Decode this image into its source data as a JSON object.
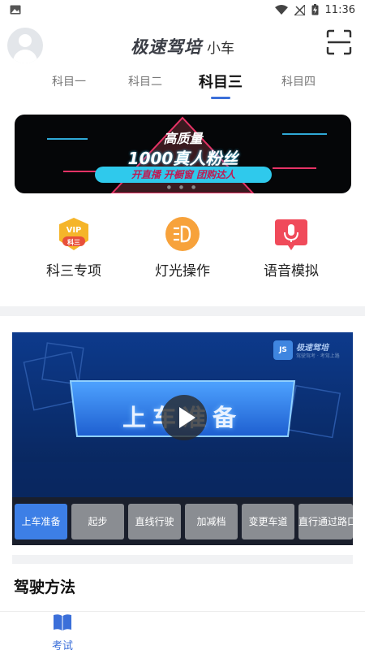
{
  "status_bar": {
    "time": "11:36"
  },
  "header": {
    "brand": "极速驾培",
    "vehicle": "小车"
  },
  "tabs": [
    "科目一",
    "科目二",
    "科目三",
    "科目四"
  ],
  "active_tab": "科目三",
  "banner": {
    "line1": "高质量",
    "line2": "1000真人粉丝",
    "line3": "开直播 开橱窗 团购达人"
  },
  "entries": [
    {
      "label": "科三专项",
      "icon": "vip-badge-icon",
      "badge_top": "VIP",
      "badge_bottom": "科三"
    },
    {
      "label": "灯光操作",
      "icon": "headlight-icon"
    },
    {
      "label": "语音模拟",
      "icon": "voice-message-icon"
    }
  ],
  "video": {
    "brand": "极速驾培",
    "brand_short": "JS",
    "slogan": "驾驶驾考 · 考驾上路",
    "title": "上车准备",
    "chapters": [
      "上车准备",
      "起步",
      "直线行驶",
      "加减档",
      "变更车道",
      "直行通过路口"
    ],
    "active_chapter": "上车准备"
  },
  "section": {
    "title": "驾驶方法"
  },
  "bottom_nav": {
    "label": "考试"
  },
  "colors": {
    "accent": "#3b6fd9",
    "video_bg": "#0b2c6e",
    "chip_active": "#3d7fe6",
    "chip_inactive": "#8a8d92"
  }
}
